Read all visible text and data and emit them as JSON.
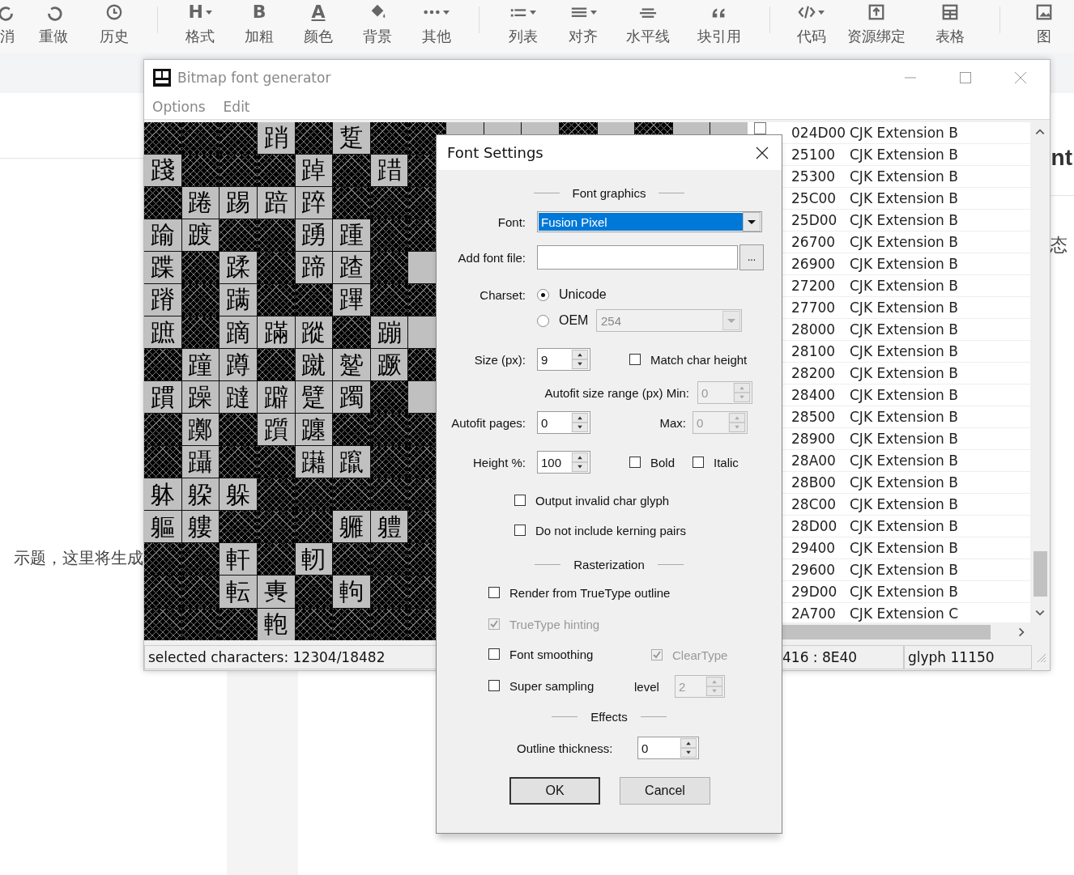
{
  "editor": {
    "toolbar": [
      {
        "label": "消",
        "kind": "icon",
        "dropdown": false
      },
      {
        "label": "重做",
        "kind": "icon",
        "dropdown": false
      },
      {
        "label": "历史",
        "kind": "icon",
        "dropdown": false
      },
      {
        "label": "格式",
        "kind": "glyph",
        "glyph": "H",
        "dropdown": true
      },
      {
        "label": "加粗",
        "kind": "glyph",
        "glyph": "B",
        "dropdown": false
      },
      {
        "label": "颜色",
        "kind": "glyph",
        "glyph": "A",
        "dropdown": false
      },
      {
        "label": "背景",
        "kind": "icon",
        "dropdown": false
      },
      {
        "label": "其他",
        "kind": "icon",
        "dropdown": true
      },
      {
        "label": "列表",
        "kind": "icon",
        "dropdown": true
      },
      {
        "label": "对齐",
        "kind": "icon",
        "dropdown": true
      },
      {
        "label": "水平线",
        "kind": "icon",
        "dropdown": false
      },
      {
        "label": "块引用",
        "kind": "icon",
        "dropdown": false
      },
      {
        "label": "代码",
        "kind": "icon",
        "dropdown": true
      },
      {
        "label": "资源绑定",
        "kind": "icon",
        "dropdown": false
      },
      {
        "label": "表格",
        "kind": "icon",
        "dropdown": false
      },
      {
        "label": "图",
        "kind": "icon",
        "dropdown": false
      }
    ],
    "left_text": "示题，这里将生成",
    "right_heading": "nt",
    "right_text": "态"
  },
  "window": {
    "title": "Bitmap font generator",
    "menu": [
      "Options",
      "Edit"
    ],
    "grid": [
      {
        "cells": [
          {
            "included": false
          },
          {
            "included": false
          },
          {
            "included": false
          },
          {
            "included": true,
            "glyph": "踃"
          },
          {
            "included": false
          },
          {
            "included": true,
            "glyph": "踅"
          },
          {
            "included": false
          },
          {
            "included": false
          },
          {
            "included": true
          },
          {
            "included": true
          },
          {
            "included": true
          },
          {
            "included": false
          },
          {
            "included": true
          },
          {
            "included": false
          },
          {
            "included": true
          },
          {
            "included": true
          }
        ]
      },
      {
        "cells": [
          {
            "included": true,
            "glyph": "踐"
          },
          {
            "included": false
          },
          {
            "included": false
          },
          {
            "included": false
          },
          {
            "included": true,
            "glyph": "踔"
          },
          {
            "included": false
          },
          {
            "included": true,
            "glyph": "踖"
          },
          {
            "included": false
          }
        ]
      },
      {
        "cells": [
          {
            "included": false
          },
          {
            "included": true,
            "glyph": "踡"
          },
          {
            "included": true,
            "glyph": "踢"
          },
          {
            "included": true,
            "glyph": "踣"
          },
          {
            "included": true,
            "glyph": "踤"
          },
          {
            "included": false
          },
          {
            "included": false
          },
          {
            "included": false
          }
        ]
      },
      {
        "cells": [
          {
            "included": true,
            "glyph": "踰"
          },
          {
            "included": true,
            "glyph": "踱"
          },
          {
            "included": false
          },
          {
            "included": false
          },
          {
            "included": true,
            "glyph": "踴"
          },
          {
            "included": true,
            "glyph": "踵"
          },
          {
            "included": false
          },
          {
            "included": false
          }
        ]
      },
      {
        "cells": [
          {
            "included": true,
            "glyph": "蹀"
          },
          {
            "included": false
          },
          {
            "included": true,
            "glyph": "蹂"
          },
          {
            "included": false
          },
          {
            "included": true,
            "glyph": "蹄"
          },
          {
            "included": true,
            "glyph": "蹅"
          },
          {
            "included": false
          },
          {
            "included": true
          }
        ]
      },
      {
        "cells": [
          {
            "included": true,
            "glyph": "蹐"
          },
          {
            "included": false
          },
          {
            "included": true,
            "glyph": "蹒"
          },
          {
            "included": false
          },
          {
            "included": false
          },
          {
            "included": true,
            "glyph": "蹕"
          },
          {
            "included": false
          },
          {
            "included": false
          }
        ]
      },
      {
        "cells": [
          {
            "included": true,
            "glyph": "蹠"
          },
          {
            "included": false
          },
          {
            "included": true,
            "glyph": "蹢"
          },
          {
            "included": true,
            "glyph": "蹣"
          },
          {
            "included": true,
            "glyph": "蹤"
          },
          {
            "included": false
          },
          {
            "included": true,
            "glyph": "蹦"
          },
          {
            "included": true
          }
        ]
      },
      {
        "cells": [
          {
            "included": false
          },
          {
            "included": true,
            "glyph": "蹱"
          },
          {
            "included": true,
            "glyph": "蹲"
          },
          {
            "included": false
          },
          {
            "included": true,
            "glyph": "蹴"
          },
          {
            "included": true,
            "glyph": "蹵"
          },
          {
            "included": true,
            "glyph": "蹶"
          },
          {
            "included": false
          }
        ]
      },
      {
        "cells": [
          {
            "included": true,
            "glyph": "躀"
          },
          {
            "included": true,
            "glyph": "躁"
          },
          {
            "included": true,
            "glyph": "躂"
          },
          {
            "included": true,
            "glyph": "躃"
          },
          {
            "included": true,
            "glyph": "躄"
          },
          {
            "included": true,
            "glyph": "躅"
          },
          {
            "included": false
          },
          {
            "included": true
          }
        ]
      },
      {
        "cells": [
          {
            "included": false
          },
          {
            "included": true,
            "glyph": "躑"
          },
          {
            "included": false
          },
          {
            "included": true,
            "glyph": "躓"
          },
          {
            "included": true,
            "glyph": "躔"
          },
          {
            "included": false
          },
          {
            "included": false
          },
          {
            "included": false
          }
        ]
      },
      {
        "cells": [
          {
            "included": false
          },
          {
            "included": true,
            "glyph": "躡"
          },
          {
            "included": false
          },
          {
            "included": false
          },
          {
            "included": true,
            "glyph": "躤"
          },
          {
            "included": true,
            "glyph": "躥"
          },
          {
            "included": false
          },
          {
            "included": false
          }
        ]
      },
      {
        "cells": [
          {
            "included": true,
            "glyph": "躰"
          },
          {
            "included": true,
            "glyph": "躱"
          },
          {
            "included": true,
            "glyph": "躲"
          },
          {
            "included": false
          },
          {
            "included": false
          },
          {
            "included": false
          },
          {
            "included": false
          },
          {
            "included": false
          }
        ]
      },
      {
        "cells": [
          {
            "included": true,
            "glyph": "軀"
          },
          {
            "included": true,
            "glyph": "軁"
          },
          {
            "included": false
          },
          {
            "included": false
          },
          {
            "included": false
          },
          {
            "included": true,
            "glyph": "軅"
          },
          {
            "included": true,
            "glyph": "軆"
          },
          {
            "included": false
          }
        ]
      },
      {
        "cells": [
          {
            "included": false
          },
          {
            "included": false
          },
          {
            "included": true,
            "glyph": "軒"
          },
          {
            "included": false
          },
          {
            "included": true,
            "glyph": "軔"
          },
          {
            "included": false
          },
          {
            "included": false
          },
          {
            "included": false
          }
        ]
      },
      {
        "cells": [
          {
            "included": false
          },
          {
            "included": false
          },
          {
            "included": true,
            "glyph": "転"
          },
          {
            "included": true,
            "glyph": "軣"
          },
          {
            "included": false
          },
          {
            "included": true,
            "glyph": "軥"
          },
          {
            "included": false
          },
          {
            "included": false
          }
        ]
      },
      {
        "cells": [
          {
            "included": false
          },
          {
            "included": false
          },
          {
            "included": false
          },
          {
            "included": true,
            "glyph": "軳"
          },
          {
            "included": false
          },
          {
            "included": false
          },
          {
            "included": false
          },
          {
            "included": false
          }
        ]
      }
    ],
    "first_row": {
      "checked": false,
      "code": "024D00",
      "name": "CJK Extension B"
    },
    "rows": [
      {
        "code": "25100",
        "name": "CJK Extension B"
      },
      {
        "code": "25300",
        "name": "CJK Extension B"
      },
      {
        "code": "25C00",
        "name": "CJK Extension B"
      },
      {
        "code": "25D00",
        "name": "CJK Extension B"
      },
      {
        "code": "26700",
        "name": "CJK Extension B"
      },
      {
        "code": "26900",
        "name": "CJK Extension B"
      },
      {
        "code": "27200",
        "name": "CJK Extension B"
      },
      {
        "code": "27700",
        "name": "CJK Extension B"
      },
      {
        "code": "28000",
        "name": "CJK Extension B"
      },
      {
        "code": "28100",
        "name": "CJK Extension B"
      },
      {
        "code": "28200",
        "name": "CJK Extension B"
      },
      {
        "code": "28400",
        "name": "CJK Extension B"
      },
      {
        "code": "28500",
        "name": "CJK Extension B"
      },
      {
        "code": "28900",
        "name": "CJK Extension B"
      },
      {
        "code": "28A00",
        "name": "CJK Extension B"
      },
      {
        "code": "28B00",
        "name": "CJK Extension B"
      },
      {
        "code": "28C00",
        "name": "CJK Extension B"
      },
      {
        "code": "28D00",
        "name": "CJK Extension B"
      },
      {
        "code": "29400",
        "name": "CJK Extension B"
      },
      {
        "code": "29600",
        "name": "CJK Extension B"
      },
      {
        "code": "29D00",
        "name": "CJK Extension B"
      },
      {
        "code": "2A700",
        "name": "CJK Extension C"
      }
    ],
    "status_bar": [
      "selected characters: 12304/18482",
      "416 : 8E40",
      "glyph 11150"
    ]
  },
  "dialog": {
    "title": "Font Settings",
    "font_graphics": {
      "heading": "Font graphics",
      "font": {
        "label": "Font:",
        "value": "Fusion Pixel"
      },
      "add_font_file": {
        "label": "Add font file:",
        "browse": "..."
      },
      "charset": {
        "label": "Charset:",
        "options": [
          {
            "label": "Unicode",
            "selected": true
          },
          {
            "label": "OEM",
            "selected": false
          }
        ],
        "oem_code": {
          "value": "254",
          "disabled": true
        }
      },
      "size": {
        "label": "Size (px):",
        "value": "9",
        "disabled": false
      },
      "match_char_height": {
        "label": "Match char height",
        "checked": false,
        "disabled": false
      },
      "autofit_min": {
        "label": "Autofit size range (px) Min:",
        "value": "0",
        "disabled": true
      },
      "autofit_pages": {
        "label": "Autofit pages:",
        "value": "0",
        "disabled": false
      },
      "autofit_max": {
        "label": "Max:",
        "value": "0",
        "disabled": true
      },
      "height": {
        "label": "Height %:",
        "value": "100",
        "disabled": false
      },
      "bold": {
        "label": "Bold",
        "checked": false,
        "disabled": false
      },
      "italic": {
        "label": "Italic",
        "checked": false,
        "disabled": false
      },
      "output_invalid_char_glyph": {
        "label": "Output invalid char glyph",
        "checked": false,
        "disabled": false
      },
      "no_kerning_pairs": {
        "label": "Do not include kerning pairs",
        "checked": false,
        "disabled": false
      }
    },
    "rasterization": {
      "heading": "Rasterization",
      "truetype_outline": {
        "label": "Render from TrueType outline",
        "checked": false,
        "disabled": false
      },
      "truetype_hinting": {
        "label": "TrueType hinting",
        "checked": true,
        "disabled": true
      },
      "font_smoothing": {
        "label": "Font smoothing",
        "checked": false,
        "disabled": false
      },
      "cleartype": {
        "label": "ClearType",
        "checked": true,
        "disabled": true
      },
      "super_sampling": {
        "label": "Super sampling",
        "checked": false,
        "disabled": false
      },
      "level": {
        "label": "level",
        "value": "2",
        "disabled": true
      }
    },
    "effects": {
      "heading": "Effects",
      "outline_thickness": {
        "label": "Outline thickness:",
        "value": "0",
        "disabled": false
      }
    },
    "buttons": [
      "OK",
      "Cancel"
    ]
  }
}
